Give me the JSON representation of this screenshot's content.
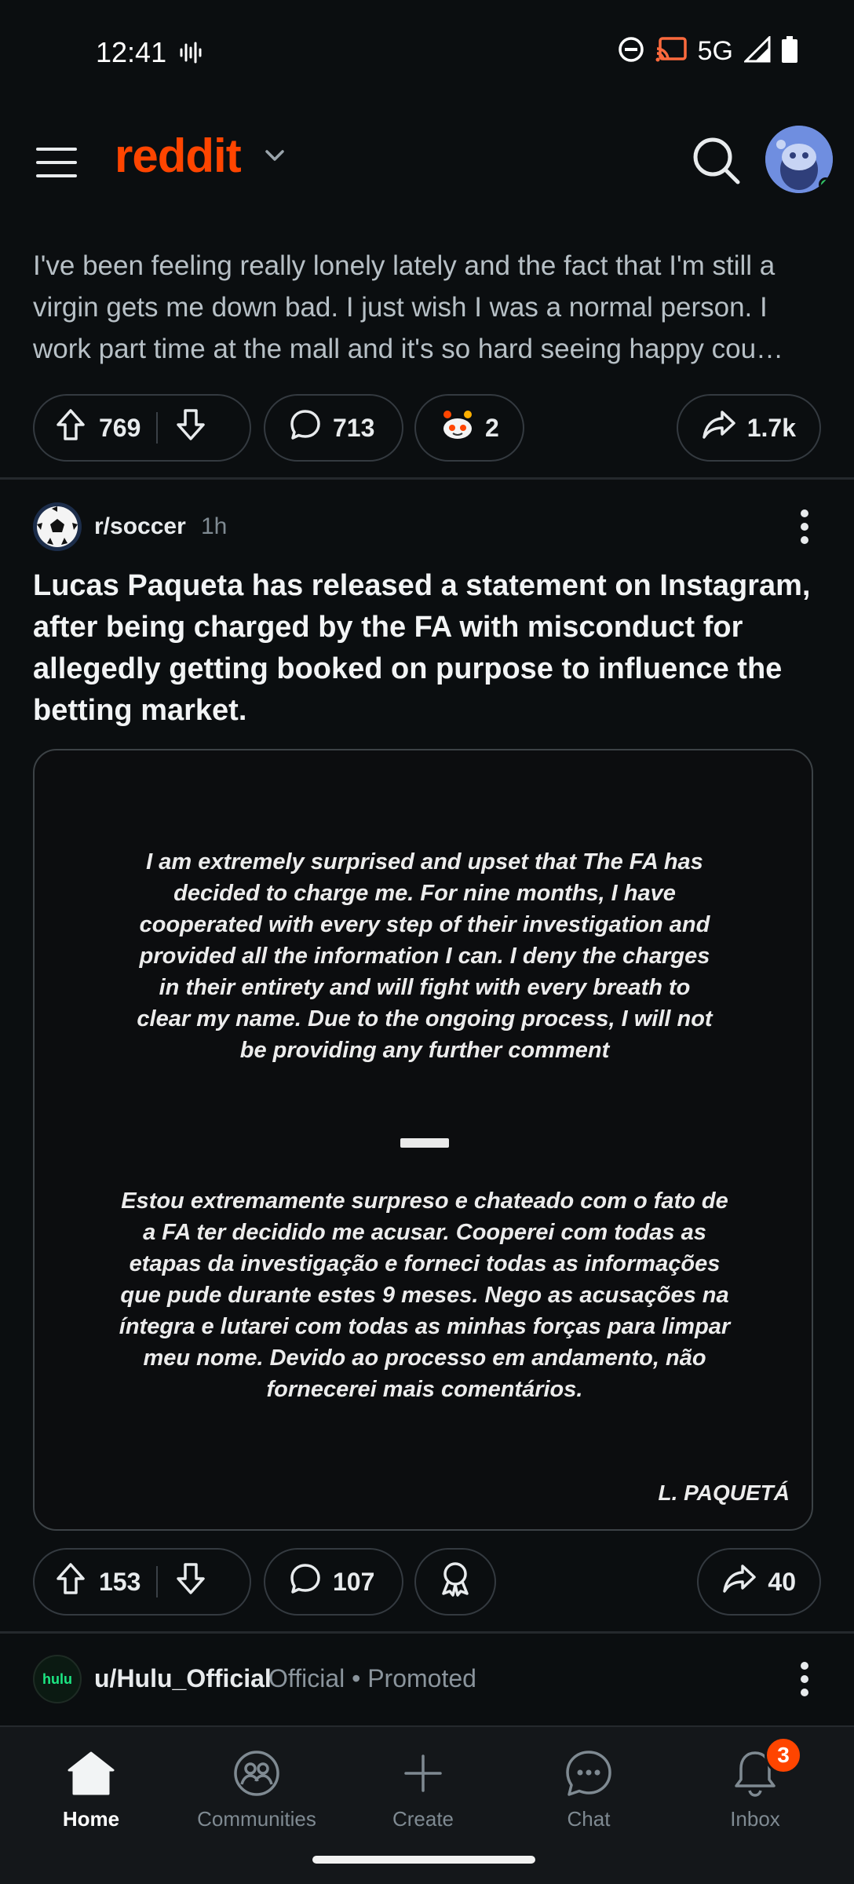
{
  "status_bar": {
    "time": "12:41",
    "network": "5G"
  },
  "app_bar": {
    "logo": "reddit"
  },
  "post_previous": {
    "body_lines": [
      "I've been feeling really lonely lately and the fact that I'm still a",
      "virgin gets me down bad. I just wish I was a normal person. I",
      "work part time at the mall and it's so hard seeing happy cou…"
    ],
    "upvotes": "769",
    "comments": "713",
    "awards": "2",
    "shares": "1.7k"
  },
  "post": {
    "subreddit": "r/soccer",
    "age": "1h",
    "title": "Lucas Paqueta has released a statement on Instagram, after being charged by the FA with misconduct for allegedly getting booked on purpose to influence the betting market.",
    "image": {
      "statement_en_lines": [
        "I am extremely surprised and upset that The FA has",
        "decided to charge me.  For nine months, I have",
        "cooperated with every step of their investigation and",
        "provided all the information I can.  I deny the charges",
        "in their entirety and will fight with every breath to",
        "clear my name.  Due to the ongoing process, I will not",
        "be providing any further comment"
      ],
      "statement_pt_lines": [
        "Estou extremamente surpreso e chateado com o fato de",
        "a FA ter decidido me acusar. Cooperei com todas as",
        "etapas da investigação e forneci todas as informações",
        "que pude durante estes 9 meses. Nego as acusações na",
        "íntegra e lutarei com todas as minhas forças para limpar",
        "meu nome. Devido ao processo em andamento, não",
        "fornecerei mais comentários."
      ],
      "signature": "L. PAQUETÁ"
    },
    "upvotes": "153",
    "comments": "107",
    "shares": "40"
  },
  "promoted": {
    "icon_text": "hulu",
    "user": "u/Hulu_Official",
    "meta": "Official • Promoted"
  },
  "bottom_nav": {
    "items": [
      {
        "label": "Home",
        "icon": "home-icon"
      },
      {
        "label": "Communities",
        "icon": "communities-icon"
      },
      {
        "label": "Create",
        "icon": "plus-icon"
      },
      {
        "label": "Chat",
        "icon": "chat-icon"
      },
      {
        "label": "Inbox",
        "icon": "bell-icon"
      }
    ],
    "inbox_badge": "3"
  },
  "colors": {
    "brand": "#ff4500",
    "background": "#0b0e10",
    "online": "#2ec35f"
  }
}
